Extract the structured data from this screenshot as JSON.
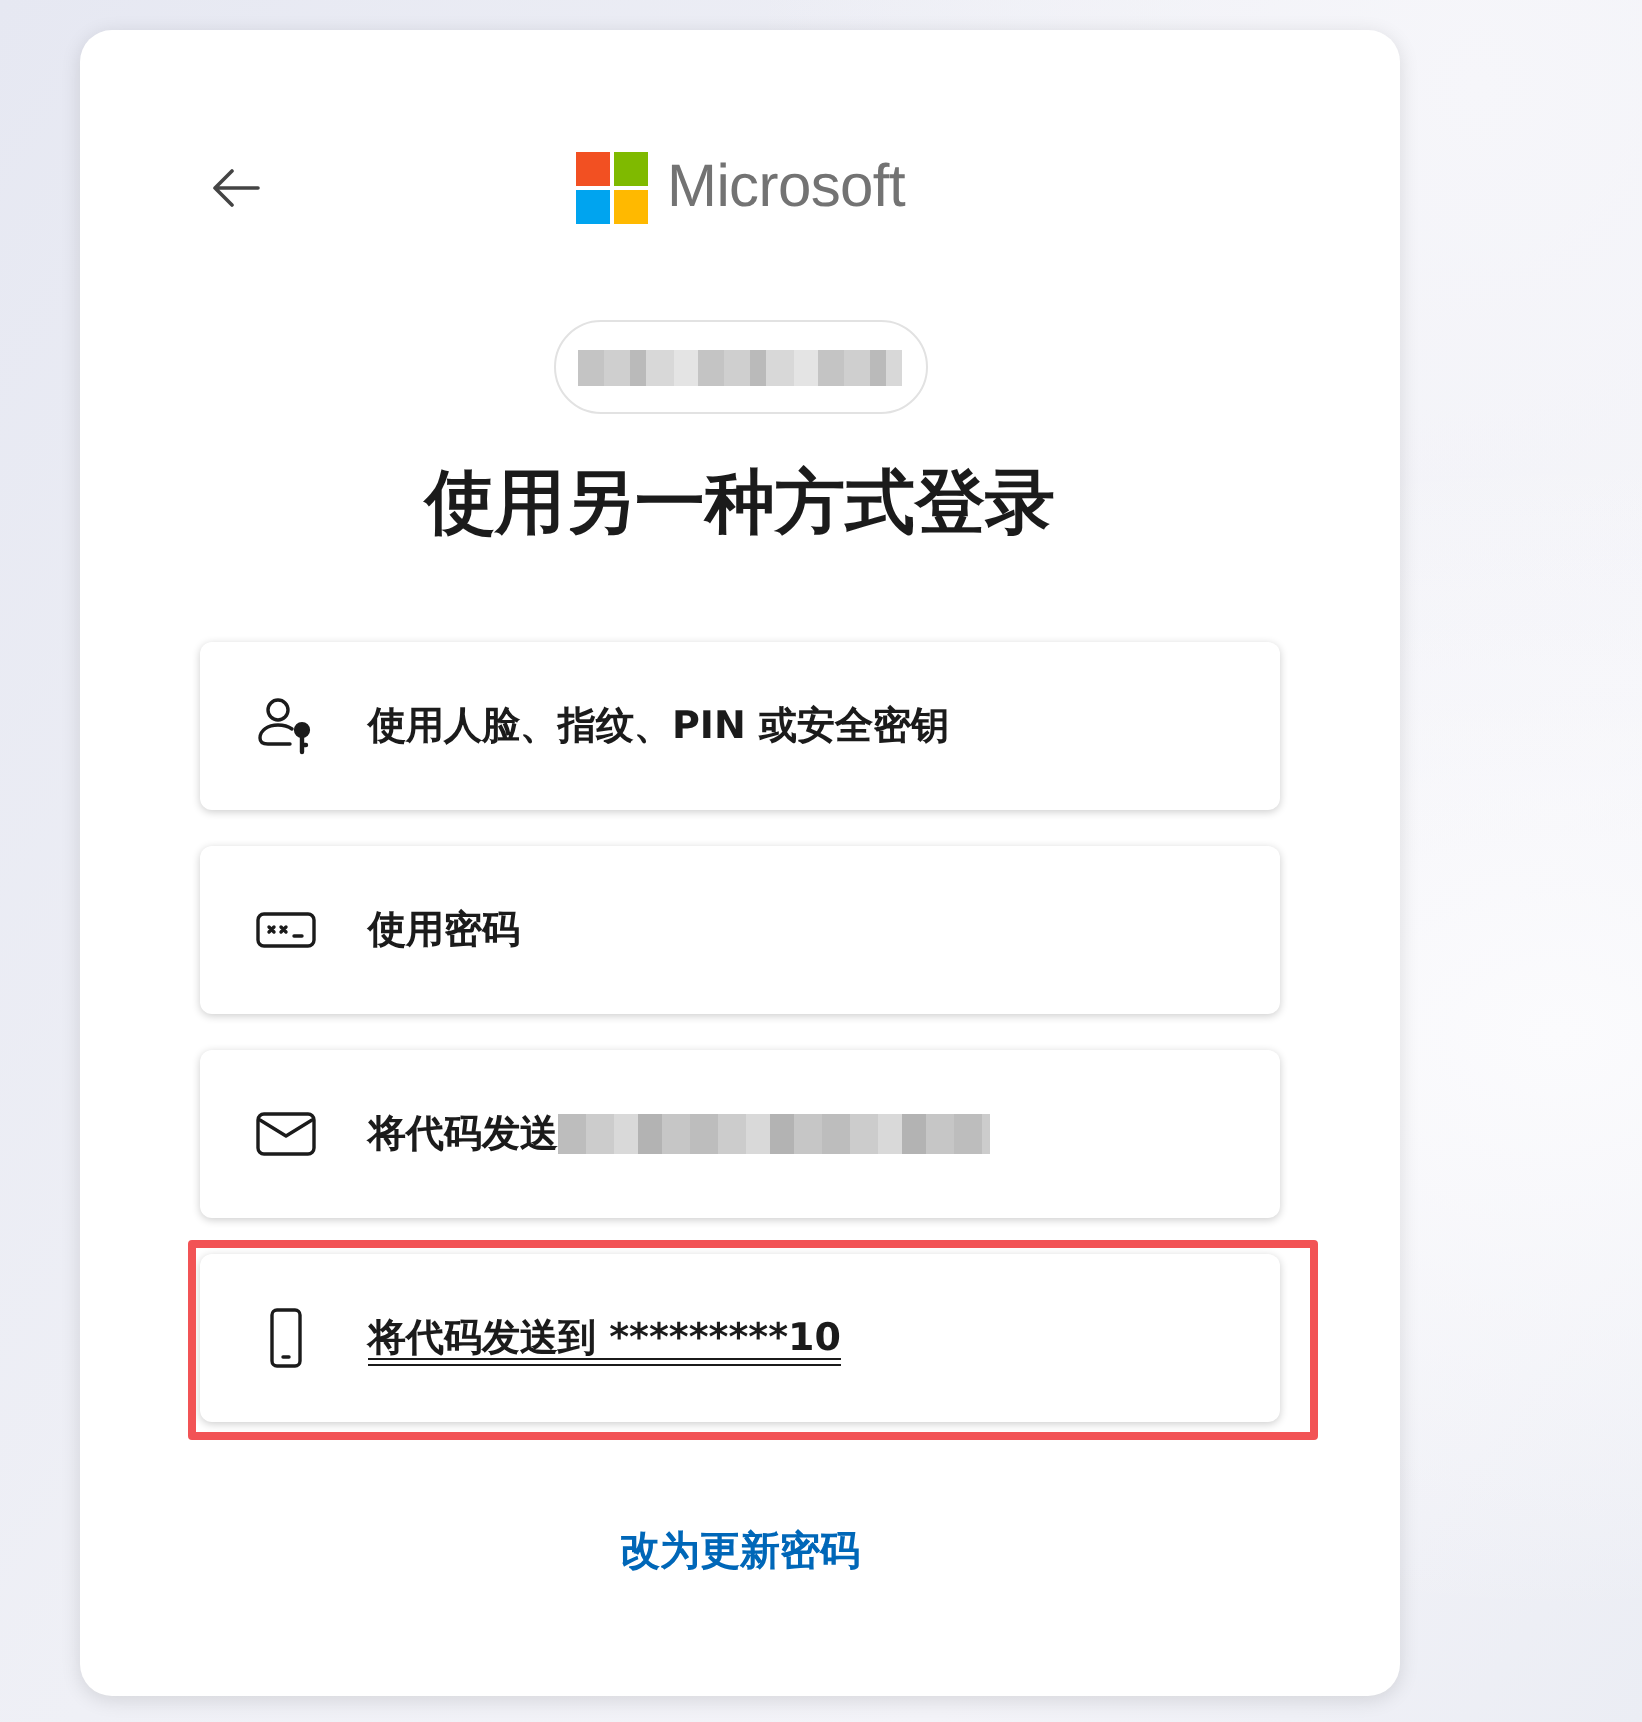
{
  "logo": {
    "wordmark": "Microsoft"
  },
  "account": {
    "redacted": true
  },
  "title": "使用另一种方式登录",
  "options": [
    {
      "kind": "passkey",
      "label": "使用人脸、指纹、PIN 或安全密钥",
      "redacted": false,
      "selected": false
    },
    {
      "kind": "password",
      "label": "使用密码",
      "redacted": false,
      "selected": false
    },
    {
      "kind": "email",
      "label": "将代码发送",
      "redacted": true,
      "selected": false
    },
    {
      "kind": "phone",
      "label": "将代码发送到 *********10",
      "redacted": false,
      "selected": true
    }
  ],
  "link": "改为更新密码"
}
